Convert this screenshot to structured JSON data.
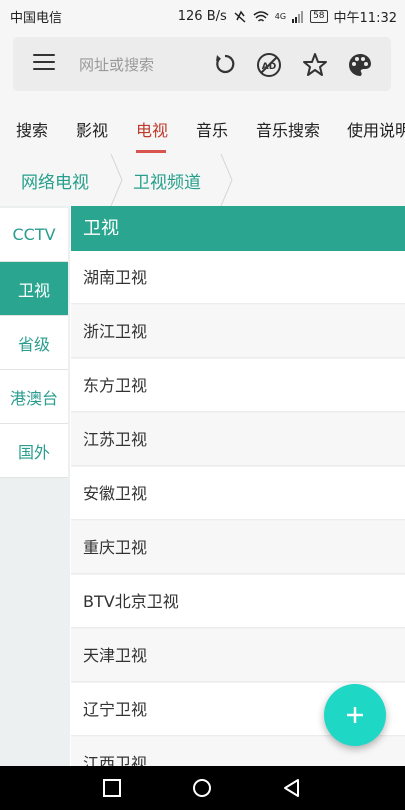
{
  "status_bar": {
    "carrier": "中国电信",
    "speed": "126 B/s",
    "network": "4G",
    "battery": "58",
    "time": "中午11:32"
  },
  "address_bar": {
    "placeholder": "网址或搜索",
    "icons": [
      "menu-icon",
      "reload-icon",
      "ad-block-icon",
      "star-icon",
      "palette-icon"
    ]
  },
  "tabs": [
    {
      "label": "搜索",
      "active": false
    },
    {
      "label": "影视",
      "active": false
    },
    {
      "label": "电视",
      "active": true
    },
    {
      "label": "音乐",
      "active": false
    },
    {
      "label": "音乐搜索",
      "active": false
    },
    {
      "label": "使用说明",
      "active": false
    }
  ],
  "breadcrumb": [
    "网络电视",
    "卫视频道"
  ],
  "sidebar": [
    {
      "label": "CCTV",
      "active": false
    },
    {
      "label": "卫视",
      "active": true
    },
    {
      "label": "省级",
      "active": false
    },
    {
      "label": "港澳台",
      "active": false
    },
    {
      "label": "国外",
      "active": false
    }
  ],
  "section_title": "卫视",
  "channels": [
    "湖南卫视",
    "浙江卫视",
    "东方卫视",
    "江苏卫视",
    "安徽卫视",
    "重庆卫视",
    "BTV北京卫视",
    "天津卫视",
    "辽宁卫视",
    "江西卫视"
  ],
  "colors": {
    "accent": "#2aa690",
    "active_tab": "#c0392b",
    "fab": "#1ed7c5"
  }
}
